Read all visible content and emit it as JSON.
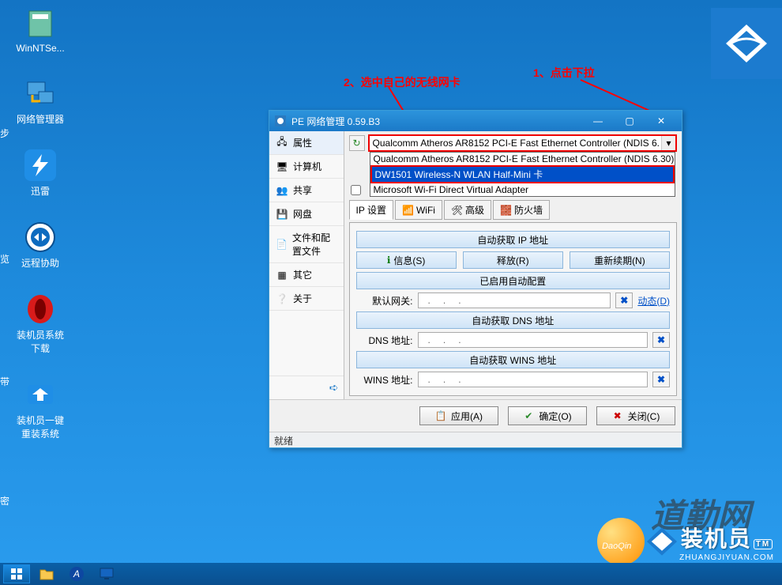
{
  "desktop": {
    "icons": [
      {
        "name": "winntsetup",
        "label": "WinNTSe..."
      },
      {
        "name": "netmgr",
        "label": "网络管理器"
      },
      {
        "name": "xunlei",
        "label": "迅雷"
      },
      {
        "name": "remote",
        "label": "远程协助"
      },
      {
        "name": "sysdl",
        "label": "装机员系统\n下载"
      },
      {
        "name": "reinstall",
        "label": "装机员一键\n重装系统"
      }
    ],
    "leftEdge": [
      "步",
      "览",
      "带",
      "密"
    ]
  },
  "annotations": {
    "a1": "1、点击下拉",
    "a2": "2、选中自己的无线网卡"
  },
  "window": {
    "title": "PE 网络管理 0.59.B3",
    "sidebar": [
      {
        "k": "props",
        "label": "属性"
      },
      {
        "k": "computer",
        "label": "计算机"
      },
      {
        "k": "share",
        "label": "共享"
      },
      {
        "k": "netdisk",
        "label": "网盘"
      },
      {
        "k": "files",
        "label": "文件和配置文件"
      },
      {
        "k": "other",
        "label": "其它"
      },
      {
        "k": "about",
        "label": "关于"
      }
    ],
    "nic": {
      "selected": "Qualcomm Atheros AR8152 PCI-E Fast Ethernet Controller (NDIS 6.",
      "options": [
        "Qualcomm Atheros AR8152 PCI-E Fast Ethernet Controller (NDIS 6.30)",
        "DW1501 Wireless-N WLAN Half-Mini 卡",
        "Microsoft Wi-Fi Direct Virtual Adapter"
      ]
    },
    "tabs": {
      "ip": "IP 设置",
      "wifi": "WiFi",
      "adv": "高级",
      "fw": "防火墙"
    },
    "ipPanel": {
      "autoIp": "自动获取 IP 地址",
      "info": "信息(S)",
      "release": "释放(R)",
      "renew": "重新续期(N)",
      "autoCfg": "已启用自动配置",
      "gateway": "默认网关:",
      "dynamic": "动态(D)",
      "autoDns": "自动获取 DNS 地址",
      "dns": "DNS 地址:",
      "autoWins": "自动获取 WINS 地址",
      "wins": "WINS 地址:"
    },
    "actions": {
      "apply": "应用(A)",
      "ok": "确定(O)",
      "close": "关闭(C)"
    },
    "status": "就绪"
  },
  "watermark": {
    "cn": "装机员",
    "en": "ZHUANGJIYUAN.COM",
    "tm": "TM",
    "dq": "道勤网"
  }
}
